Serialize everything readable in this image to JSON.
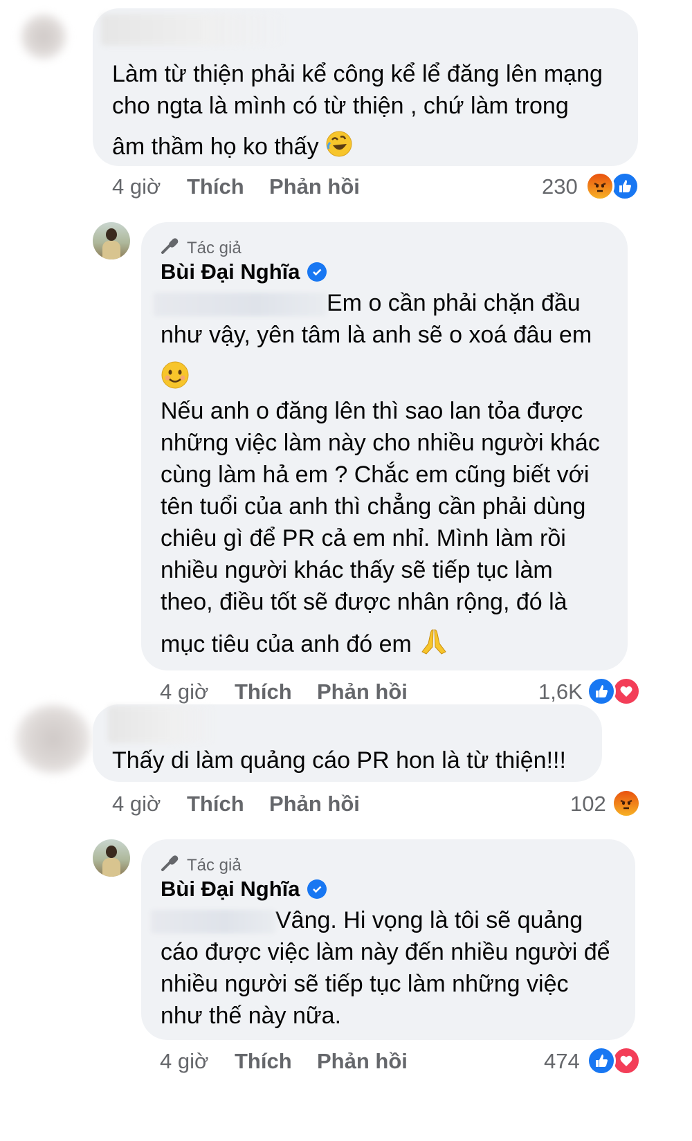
{
  "comments": [
    {
      "text_lines": [
        "Làm từ thiện phải kể công kể lể đăng lên mạng",
        "cho ngta là mình có từ thiện , chứ làm trong",
        "âm thầm họ ko thấy"
      ],
      "time": "4 giờ",
      "like_label": "Thích",
      "reply_label": "Phản hồi",
      "reaction_count": "230",
      "reactions": [
        "angry-icon",
        "like-icon"
      ]
    },
    {
      "author_tag": "Tác giả",
      "author_name": "Bùi Đại Nghĩa",
      "text_lines": [
        "Em o cần phải chặn đầu",
        "như vậy, yên tâm là anh sẽ o xoá đâu em",
        "Nếu anh o đăng lên thì sao lan tỏa được",
        "những việc làm này cho nhiều người khác",
        "cùng làm hả em ? Chắc em cũng biết với",
        "tên tuổi của anh thì chẳng cần phải dùng",
        "chiêu gì để PR cả em nhỉ. Mình làm rồi",
        "nhiều người khác thấy sẽ tiếp tục làm",
        "theo, điều tốt sẽ được nhân rộng, đó là",
        "mục tiêu của anh đó em"
      ],
      "time": "4 giờ",
      "like_label": "Thích",
      "reply_label": "Phản hồi",
      "reaction_count": "1,6K",
      "reactions": [
        "like-icon",
        "love-icon"
      ]
    },
    {
      "text_lines": [
        "Thấy di làm quảng cáo  PR hon là từ thiện!!!"
      ],
      "time": "4 giờ",
      "like_label": "Thích",
      "reply_label": "Phản hồi",
      "reaction_count": "102",
      "reactions": [
        "angry-icon"
      ]
    },
    {
      "author_tag": "Tác giả",
      "author_name": "Bùi Đại Nghĩa",
      "text_lines": [
        "Vâng. Hi vọng là tôi sẽ quảng",
        "cáo được việc làm này đến nhiều người để",
        "nhiều người sẽ tiếp tục làm những việc",
        "như thế này nữa."
      ],
      "time": "4 giờ",
      "like_label": "Thích",
      "reply_label": "Phản hồi",
      "reaction_count": "474",
      "reactions": [
        "like-icon",
        "love-icon"
      ]
    }
  ],
  "colors": {
    "bubble": "#f0f2f5",
    "text": "#050505",
    "meta": "#65676b",
    "like": "#1877f2",
    "love": "#f33e58",
    "verified": "#1877f2"
  }
}
